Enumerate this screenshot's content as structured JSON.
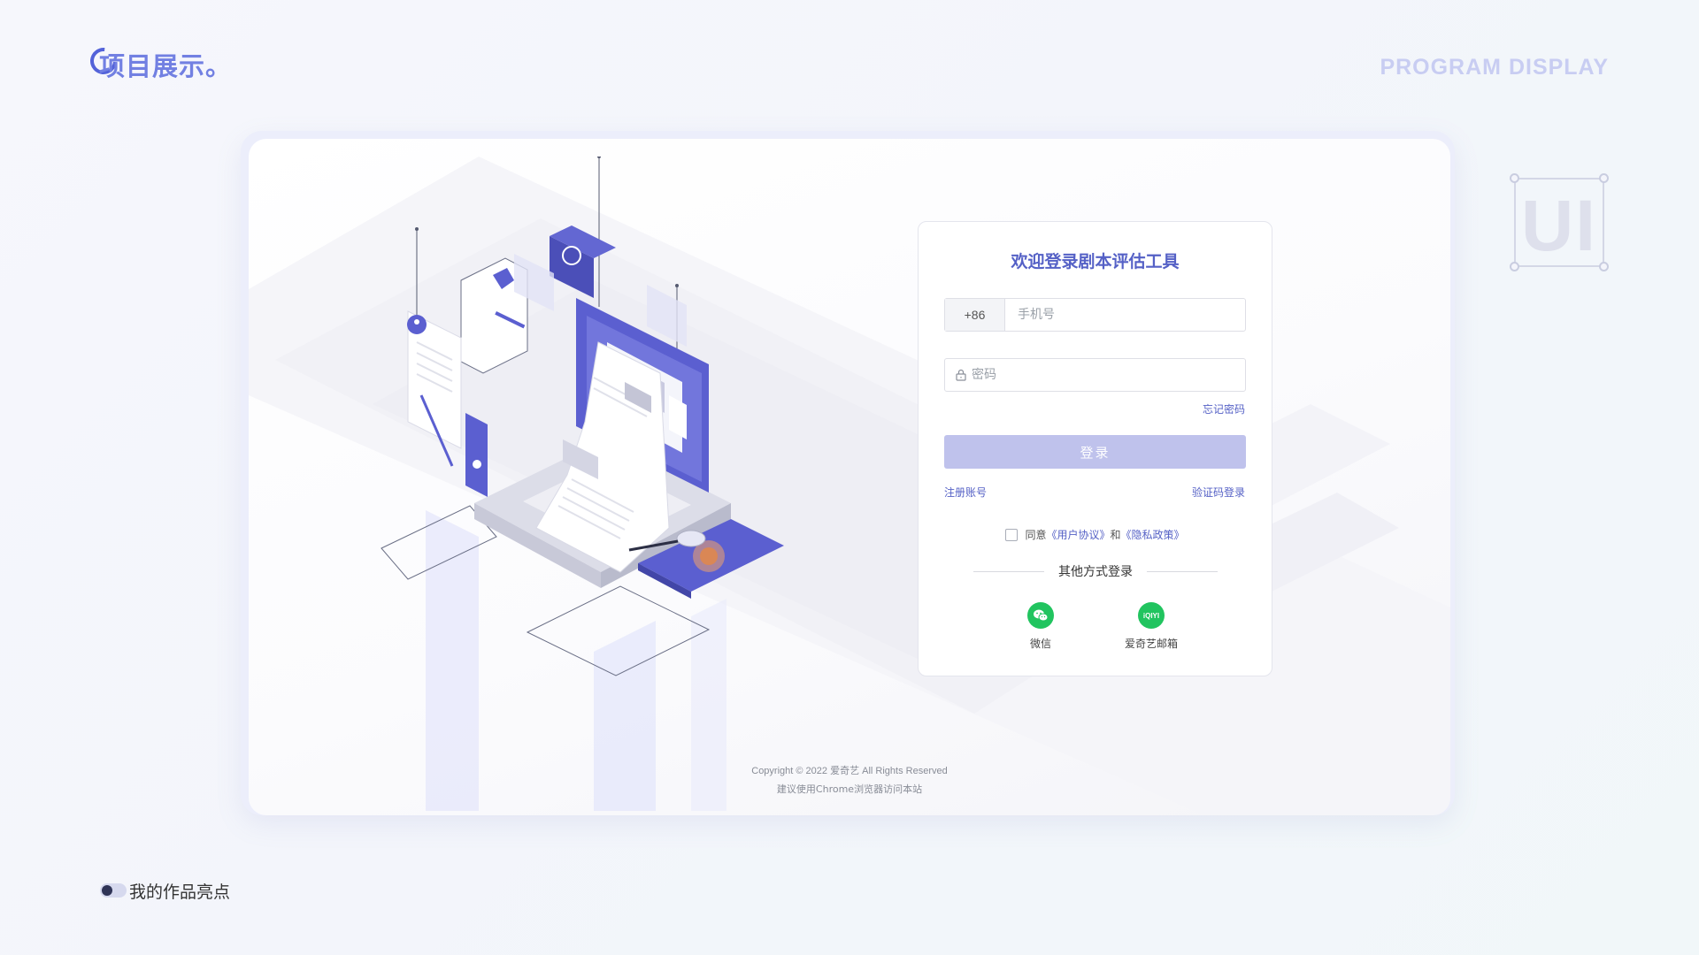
{
  "header": {
    "brand_title": "项目展示。",
    "top_right_title": "PROGRAM DISPLAY"
  },
  "deco": {
    "ui_text": "UI"
  },
  "login": {
    "title": "欢迎登录剧本评估工具",
    "country_code": "+86",
    "phone_placeholder": "手机号",
    "password_placeholder": "密码",
    "forgot_password": "忘记密码",
    "login_button": "登录",
    "register_link": "注册账号",
    "sms_login_link": "验证码登录",
    "agree_prefix": "同意",
    "user_agreement": "《用户协议》",
    "agree_and": "和",
    "privacy_policy": "《隐私政策》",
    "other_methods": "其他方式登录",
    "social": [
      {
        "label": "微信",
        "icon": "wechat-icon"
      },
      {
        "label": "爱奇艺邮箱",
        "icon": "iqiyi-icon",
        "badge": "iQIYI"
      }
    ]
  },
  "footer": {
    "copyright": "Copyright © 2022 爱奇艺 All Rights Reserved",
    "browser_tip": "建议使用Chrome浏览器访问本站"
  },
  "caption": {
    "text": "我的作品亮点"
  },
  "colors": {
    "accent": "#5561c6",
    "accent_light": "#bfc2ec",
    "social_green": "#21c45f",
    "brand_blue": "#7280e2"
  }
}
